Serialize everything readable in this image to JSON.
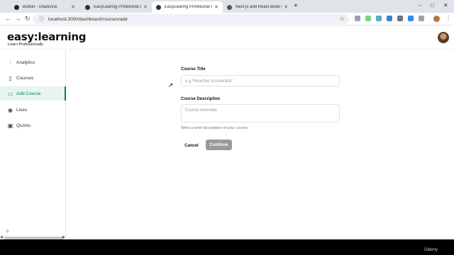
{
  "browser": {
    "tabs": [
      {
        "title": "Button - shadcn/ui",
        "color": "#222222",
        "active": false
      },
      {
        "title": "EasyLearing Profetional Course",
        "color": "#333333",
        "active": false
      },
      {
        "title": "EasyLearing Profetional Course",
        "color": "#333333",
        "active": true
      },
      {
        "title": "Next js and React Build Compl",
        "color": "#555555",
        "active": false
      }
    ],
    "new_tab": "+",
    "url": "localhost:3000/dashboard/courses/add",
    "window_controls": [
      "–",
      "□",
      "✕"
    ]
  },
  "header": {
    "logo": "easy:learning",
    "tagline": "Learn Professionally"
  },
  "sidebar": {
    "items": [
      {
        "label": "Analytics",
        "icon": "bar-chart-icon",
        "glyph": "⫶"
      },
      {
        "label": "Courses",
        "icon": "book-icon",
        "glyph": "▯"
      },
      {
        "label": "Add Course",
        "icon": "book-open-icon",
        "glyph": "▭",
        "active": true
      },
      {
        "label": "Lives",
        "icon": "radio-icon",
        "glyph": "◉"
      },
      {
        "label": "Quizes",
        "icon": "quiz-icon",
        "glyph": "▣"
      }
    ],
    "accent": "#0f766e"
  },
  "form": {
    "title_label": "Course Title",
    "title_placeholder": "e.g 'Reactive Accelerator'",
    "description_label": "Course Description",
    "description_placeholder": "Course overview",
    "description_hint": "Write a brief description of your course",
    "cancel_label": "Cancel",
    "continue_label": "Continue"
  },
  "watermark": "Üdemy"
}
